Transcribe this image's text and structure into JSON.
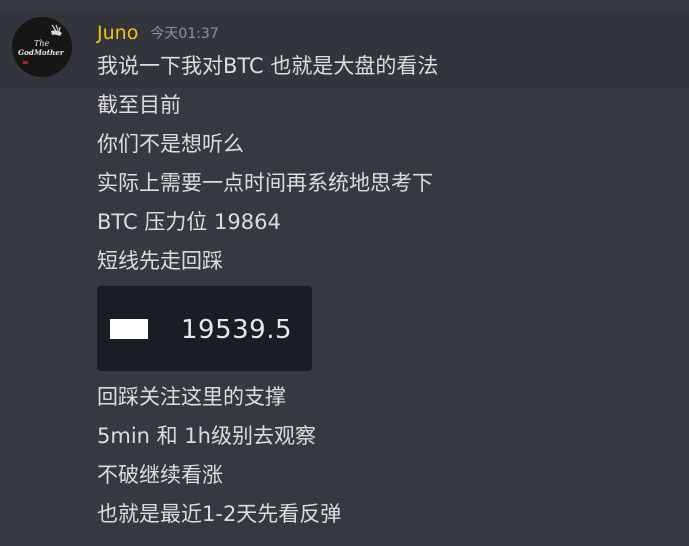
{
  "message": {
    "author": "Juno",
    "timestamp": "今天01:37",
    "author_color": "#f1c40f",
    "avatar_icon": "godfather-avatar-icon",
    "avatar_text_top": "The",
    "avatar_text_bottom": "GodMother",
    "lines_before": [
      "我说一下我对BTC 也就是大盘的看法",
      "截至目前",
      "你们不是想听么",
      "实际上需要一点时间再系统地思考下",
      "BTC 压力位 19864",
      "短线先走回踩"
    ],
    "image_embed": {
      "price": "19539.5"
    },
    "lines_after": [
      "回踩关注这里的支撑",
      "5min 和 1h级别去观察",
      "不破继续看涨",
      "也就是最近1-2天先看反弹"
    ]
  }
}
